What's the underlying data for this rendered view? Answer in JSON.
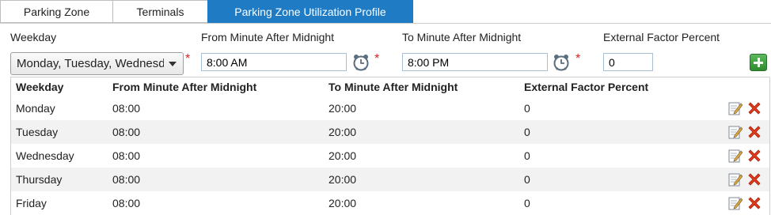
{
  "tabs": [
    {
      "label": "Parking Zone",
      "active": false
    },
    {
      "label": "Terminals",
      "active": false
    },
    {
      "label": "Parking Zone Utilization Profile",
      "active": true
    }
  ],
  "form": {
    "weekday_label": "Weekday",
    "weekday_value": "Monday, Tuesday, Wednesday, Thursday, Friday",
    "from_label": "From Minute After Midnight",
    "from_value": "8:00 AM",
    "to_label": "To Minute After Midnight",
    "to_value": "8:00 PM",
    "factor_label": "External Factor Percent",
    "factor_value": "0",
    "required_mark": "*"
  },
  "table": {
    "headers": [
      "Weekday",
      "From Minute After Midnight",
      "To Minute After Midnight",
      "External Factor Percent"
    ],
    "rows": [
      {
        "weekday": "Monday",
        "from": "08:00",
        "to": "20:00",
        "factor": "0"
      },
      {
        "weekday": "Tuesday",
        "from": "08:00",
        "to": "20:00",
        "factor": "0"
      },
      {
        "weekday": "Wednesday",
        "from": "08:00",
        "to": "20:00",
        "factor": "0"
      },
      {
        "weekday": "Thursday",
        "from": "08:00",
        "to": "20:00",
        "factor": "0"
      },
      {
        "weekday": "Friday",
        "from": "08:00",
        "to": "20:00",
        "factor": "0"
      }
    ]
  },
  "icons": {
    "clock": "clock-icon",
    "add": "add-icon",
    "edit": "edit-icon",
    "delete": "delete-icon"
  },
  "colors": {
    "accent": "#1e7bc4",
    "required": "#e02020",
    "add": "#3a9a3a",
    "delete": "#e03a1a"
  }
}
